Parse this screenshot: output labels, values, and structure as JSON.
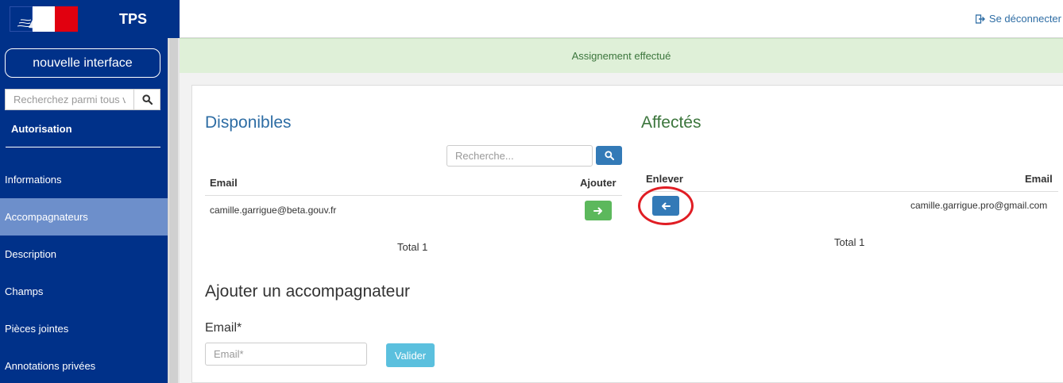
{
  "brand": {
    "title": "TPS"
  },
  "header": {
    "logout_label": "Se déconnecter"
  },
  "sidebar": {
    "new_interface_label": "nouvelle interface",
    "search_placeholder": "Recherchez parmi tous v",
    "heading": "Autorisation",
    "items": [
      {
        "label": "Informations",
        "active": false
      },
      {
        "label": "Accompagnateurs",
        "active": true
      },
      {
        "label": "Description",
        "active": false
      },
      {
        "label": "Champs",
        "active": false
      },
      {
        "label": "Pièces jointes",
        "active": false
      },
      {
        "label": "Annotations privées",
        "active": false
      }
    ]
  },
  "alert": {
    "message": "Assignement effectué"
  },
  "disponibles": {
    "title": "Disponibles",
    "search_placeholder": "Recherche...",
    "col_email": "Email",
    "col_action": "Ajouter",
    "rows": [
      {
        "email": "camille.garrigue@beta.gouv.fr"
      }
    ],
    "total": "Total 1"
  },
  "affectes": {
    "title": "Affectés",
    "col_action": "Enlever",
    "col_email": "Email",
    "rows": [
      {
        "email": "camille.garrigue.pro@gmail.com"
      }
    ],
    "total": "Total 1"
  },
  "add_form": {
    "title": "Ajouter un accompagnateur",
    "email_label": "Email*",
    "email_placeholder": "Email*",
    "submit_label": "Valider"
  },
  "colors": {
    "sidebar_bg": "#003189",
    "sidebar_active": "#6d8fcb",
    "primary": "#337ab7",
    "success": "#5cb85c",
    "info": "#5bc0de",
    "alert_bg": "#dff0d8",
    "highlight_ring": "#e01d24"
  },
  "icons": {
    "logout": "sign-out-icon",
    "search": "search-icon",
    "add": "arrow-right-icon",
    "remove": "arrow-left-icon"
  }
}
